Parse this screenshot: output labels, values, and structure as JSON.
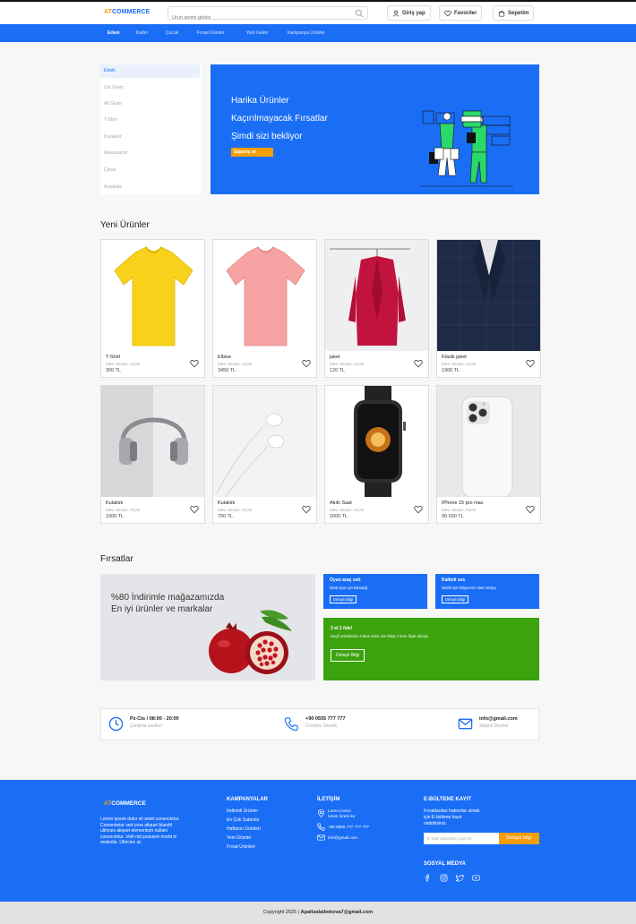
{
  "brand": {
    "part1": "AT",
    "part2": "COMMERCE",
    "accent": "#1a6ef5",
    "orange": "#f59e0b"
  },
  "header": {
    "search_placeholder": "Ürün ismini giriniz",
    "login_label": "Giriş yap",
    "favorites_label": "Favoriler",
    "cart_label": "Sepetim"
  },
  "nav": {
    "items": [
      "Erkek",
      "Kadın",
      "Çocuk",
      "Fırsat Ürünler",
      "Yeni Gelen",
      "Kampanya Ürünler"
    ],
    "active": "Erkek"
  },
  "sidebar": {
    "items": [
      "Erkek",
      "Üst Giyim",
      "Alt Giyim",
      "T-Shirt",
      "Kazakler",
      "Aksesuarlar",
      "Çanta",
      "Ayakkabı"
    ],
    "active": "Erkek"
  },
  "hero": {
    "line1": "Harika Ürünler",
    "line2": "Kaçırılmayacak Fırsatlar",
    "line3": "Şimdi sizi bekliyor",
    "button": "Sipariş et"
  },
  "new_products": {
    "title": "Yeni Ürünler",
    "items": [
      {
        "name": "T-Shirt",
        "colors": "Mavi, Beyaz, Siyah",
        "price": "300 TL",
        "image": "yellow-tshirt"
      },
      {
        "name": "Elbise",
        "colors": "Mavi, Beyaz, Siyah",
        "price": "3450 TL",
        "image": "pink-tshirt"
      },
      {
        "name": "jaket",
        "colors": "Mavi, Beyaz, Siyah",
        "price": "120 TL",
        "image": "red-blazer"
      },
      {
        "name": "Klasik jaket",
        "colors": "Mavi, Beyaz, Siyah",
        "price": "1900 TL",
        "image": "suit-jacket"
      },
      {
        "name": "Kulaklık",
        "colors": "Mavi, Beyaz, Siyah",
        "price": "1000 TL",
        "image": "headphones"
      },
      {
        "name": "Kulaklık",
        "colors": "Mavi, Beyaz, Siyah",
        "price": "700 TL",
        "image": "earphones"
      },
      {
        "name": "Akıllı Saat",
        "colors": "Mavi, Beyaz, Siyah",
        "price": "2000 TL",
        "image": "smart-watch"
      },
      {
        "name": "IPhone 15 pro max",
        "colors": "Mavi, Beyaz, Siyah",
        "price": "90.000 TL",
        "image": "iphone"
      }
    ]
  },
  "deals": {
    "title": "Fırsatlar",
    "big": {
      "line1": "%80 İndirimle mağazamızda",
      "line2": "En iyi ürünler ve markalar"
    },
    "small1": {
      "title": "Oyun araç seti",
      "desc": "İdeal spor için teknoloji",
      "button": "Detaylı Bilgi"
    },
    "small2": {
      "title": "Kaliteli ses",
      "desc": "Müzik için ihtiyacınız olan herşey",
      "button": "Detaylı Bilgi"
    },
    "green": {
      "title": "3 al 2 öde!",
      "desc": "Seçili ürünlerden 3 tane satın alın fakat 2 ürün fiyatı ödeyin.",
      "button": "Detaylı Bilgi"
    }
  },
  "info": [
    {
      "main": "Pz-Cts / 08:00 - 20:00",
      "sub": "Çalışma saatleri",
      "icon": "clock-icon"
    },
    {
      "main": "+90 0555 777 777",
      "sub": "Ücretsiz Destek",
      "icon": "phone-icon"
    },
    {
      "main": "info@gmail.com",
      "sub": "Siparis Destek",
      "icon": "mail-icon"
    }
  ],
  "footer": {
    "description": "Lorem ipsum dolor sit amet consectetur. Consectetur sed urna aliquet blandit ultricies aliquet elementum nullam consectetur. Velit nisl posuere morbi in molestie. Ultricies at.",
    "campaigns_title": "KAMPANYALAR",
    "campaigns": [
      "İndirimli Ürünler",
      "En Çok Satanlar",
      "Haftanın Ürünleri",
      "Yeni Ürünler",
      "Fırsat Ürünleri"
    ],
    "contact_title": "İLETİŞİM",
    "address_line1": "Lorem lorem",
    "address_line2": "lorem lorem ke",
    "phone": "+90 0555 777 777 777",
    "email": "info@gmail.com",
    "newsletter_title": "E-BÜLTENE KAYIT",
    "newsletter_line1": "Fırsatlardan haberdar olmak",
    "newsletter_line2": "için E-bültene kayıt",
    "newsletter_line3": "olabilirsiniz.",
    "email_placeholder": "E-mail adresinizi yazınız",
    "newsletter_button": "Detaylı bilgi",
    "social_title": "SOSYAL MEDYA",
    "social": [
      "facebook-icon",
      "instagram-icon",
      "twitter-icon",
      "youtube-icon"
    ]
  },
  "copyright": {
    "text": "Copyright  2025 | ",
    "email": "Apaltsalaibekova7@gmail.com"
  }
}
